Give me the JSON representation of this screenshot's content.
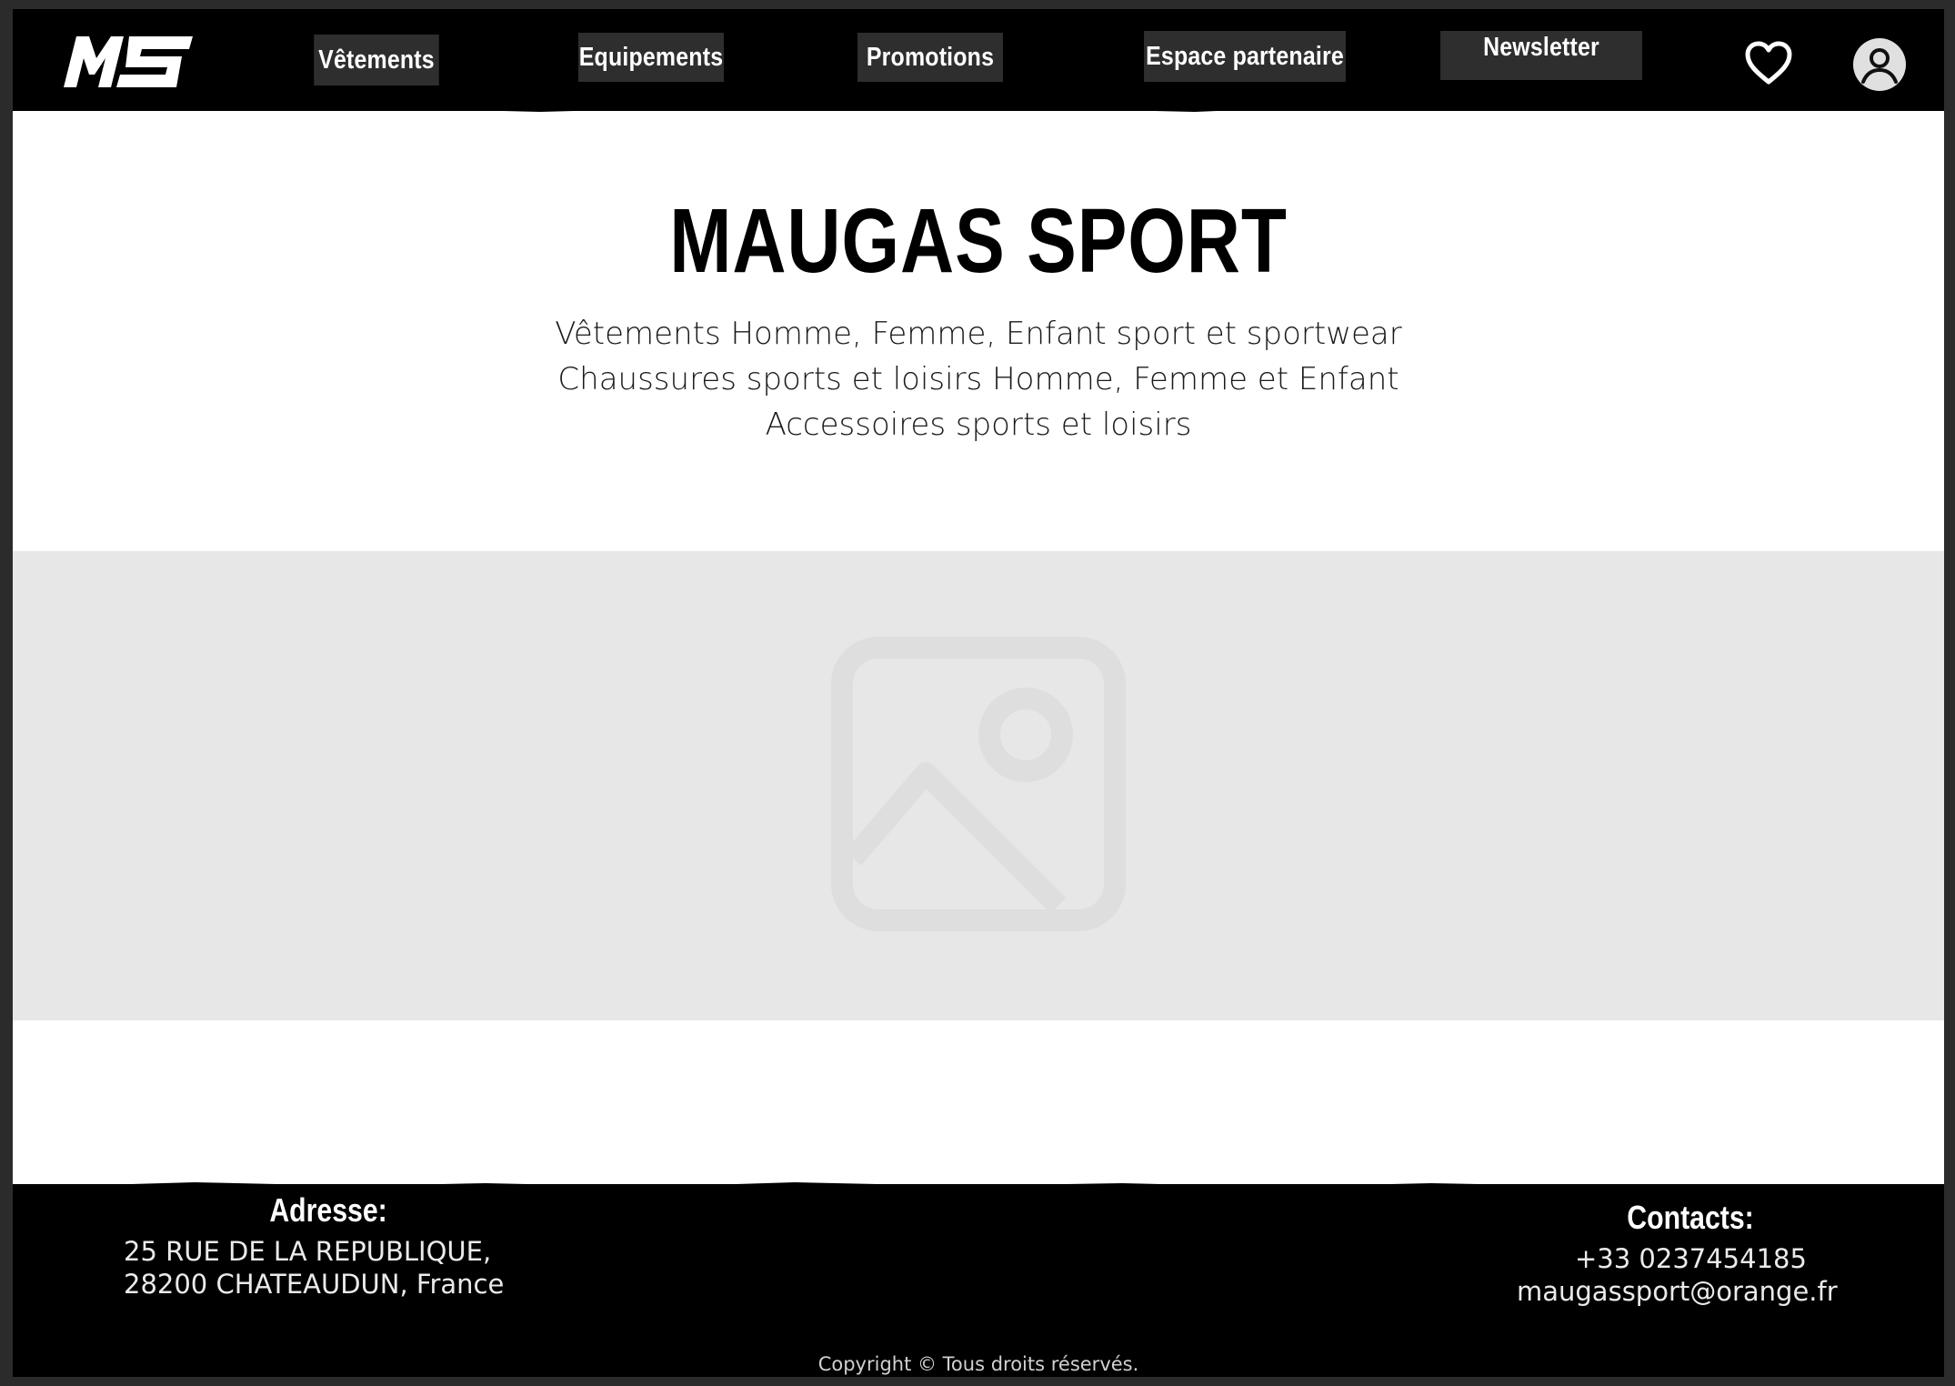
{
  "header": {
    "logo_text": "MS",
    "nav": [
      {
        "label": "Vêtements"
      },
      {
        "label": "Equipements"
      },
      {
        "label": "Promotions"
      },
      {
        "label": "Espace partenaire"
      },
      {
        "label": "Newsletter"
      }
    ],
    "icons": [
      "heart-icon",
      "user-account-icon"
    ]
  },
  "hero": {
    "title": "MAUGAS SPORT",
    "lines": [
      "Vêtements Homme, Femme, Enfant sport et sportwear",
      "Chaussures sports et loisirs Homme, Femme et Enfant",
      "Accessoires sports et loisirs"
    ]
  },
  "image_placeholder": {
    "icon": "image-placeholder-icon"
  },
  "footer": {
    "address_heading": "Adresse:",
    "address_lines": [
      "25 RUE DE LA REPUBLIQUE,",
      "28200 CHATEAUDUN, France"
    ],
    "contacts_heading": "Contacts:",
    "phone": "+33 0237454185",
    "email": "maugassport@orange.fr",
    "copyright": "Copyright © Tous droits réservés."
  },
  "colors": {
    "header_bg": "#000000",
    "nav_button_bg": "#2e2e2e",
    "placeholder_bg": "#e7e7e7",
    "footer_bg": "#000000"
  }
}
